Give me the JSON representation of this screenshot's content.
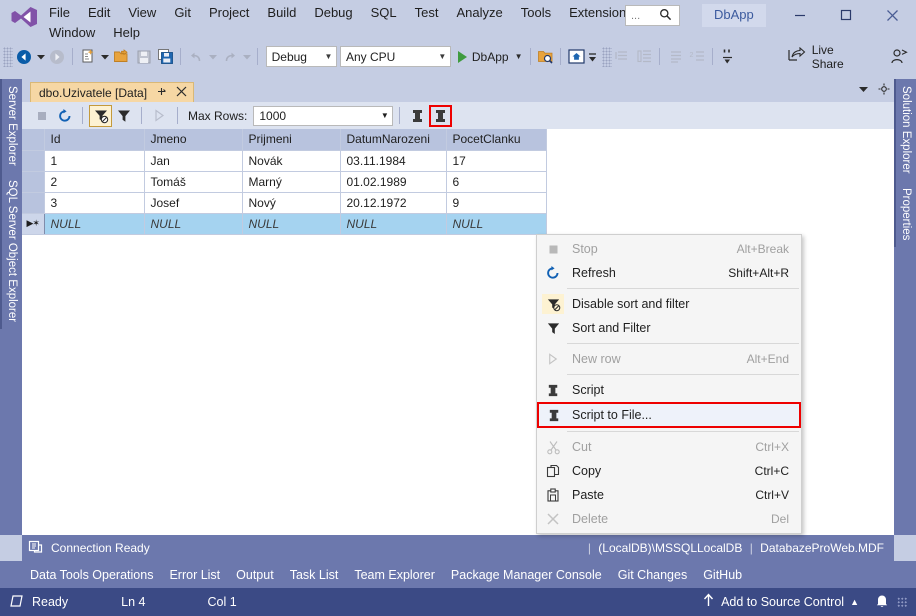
{
  "window": {
    "title": "DbApp",
    "logo_icon": "visual-studio-logo",
    "minimize_icon": "minimize-icon",
    "maximize_icon": "maximize-icon",
    "close_icon": "close-icon"
  },
  "menubar": {
    "row1": [
      "File",
      "Edit",
      "View",
      "Git",
      "Project",
      "Build",
      "Debug",
      "SQL",
      "Test",
      "Analyze",
      "Tools",
      "Extensions"
    ],
    "row2": [
      "Window",
      "Help"
    ],
    "search": {
      "dots": "...",
      "icon": "search-icon",
      "placeholder": "Search"
    }
  },
  "toolbar": {
    "back_icon": "navigate-back-icon",
    "forward_icon": "navigate-forward-icon",
    "new_item_icon": "new-item-icon",
    "open_icon": "open-file-icon",
    "save_icon": "save-icon",
    "save_all_icon": "save-all-icon",
    "undo_icon": "undo-icon",
    "redo_icon": "redo-icon",
    "config": "Debug",
    "platform": "Any CPU",
    "run_label": "DbApp",
    "run_icon": "play-icon",
    "find_icon": "find-in-files-icon",
    "home_icon": "solution-home-icon",
    "indent_left_icon": "outdent-icon",
    "indent_right_icon": "indent-icon",
    "comment_icon": "comment-icon",
    "uncomment_icon": "uncomment-icon",
    "bookmark_icon": "bookmark-icon",
    "live_share_label": "Live Share",
    "live_share_icon": "live-share-icon",
    "feedback_icon": "send-feedback-icon"
  },
  "dock_left": [
    "Server Explorer",
    "SQL Server Object Explorer"
  ],
  "dock_right": [
    "Solution Explorer",
    "Properties"
  ],
  "document": {
    "tab_title": "dbo.Uzivatele [Data]",
    "pin_icon": "pin-icon",
    "close_icon": "close-tab-icon",
    "tab_list_icon": "tab-list-icon",
    "tab_menu_icon": "tab-menu-icon"
  },
  "grid_toolbar": {
    "stop_icon": "stop-icon",
    "refresh_icon": "refresh-icon",
    "disable_sort_filter_icon": "disable-sort-filter-icon",
    "sort_filter_icon": "sort-filter-icon",
    "new_row_icon": "new-row-icon",
    "max_rows_label": "Max Rows:",
    "max_rows_value": "1000",
    "script_icon": "script-icon",
    "script_to_file_icon": "script-to-file-icon"
  },
  "grid": {
    "columns": [
      "Id",
      "Jmeno",
      "Prijmeni",
      "DatumNarozeni",
      "PocetClanku"
    ],
    "rows": [
      {
        "Id": "1",
        "Jmeno": "Jan",
        "Prijmeni": "Novák",
        "DatumNarozeni": "03.11.1984",
        "PocetClanku": "17"
      },
      {
        "Id": "2",
        "Jmeno": "Tomáš",
        "Prijmeni": "Marný",
        "DatumNarozeni": "01.02.1989",
        "PocetClanku": "6"
      },
      {
        "Id": "3",
        "Jmeno": "Josef",
        "Prijmeni": "Nový",
        "DatumNarozeni": "20.12.1972",
        "PocetClanku": "9"
      }
    ],
    "new_row": {
      "Id": "NULL",
      "Jmeno": "NULL",
      "Prijmeni": "NULL",
      "DatumNarozeni": "NULL",
      "PocetClanku": "NULL"
    },
    "new_row_marker": "▶✶"
  },
  "context_menu": {
    "items": [
      {
        "label": "Stop",
        "shortcut": "Alt+Break",
        "icon": "stop-icon",
        "disabled": true,
        "highlighted": false
      },
      {
        "label": "Refresh",
        "shortcut": "Shift+Alt+R",
        "icon": "refresh-icon",
        "disabled": false,
        "highlighted": false
      },
      {
        "separator": true
      },
      {
        "label": "Disable sort and filter",
        "shortcut": "",
        "icon": "disable-sort-filter-icon",
        "disabled": false,
        "highlighted": false
      },
      {
        "label": "Sort and Filter",
        "shortcut": "",
        "icon": "sort-filter-icon",
        "disabled": false,
        "highlighted": false
      },
      {
        "separator": true
      },
      {
        "label": "New row",
        "shortcut": "Alt+End",
        "icon": "new-row-icon",
        "disabled": true,
        "highlighted": false
      },
      {
        "separator": true
      },
      {
        "label": "Script",
        "shortcut": "",
        "icon": "script-icon",
        "disabled": false,
        "highlighted": false
      },
      {
        "label": "Script to File...",
        "shortcut": "",
        "icon": "script-to-file-icon",
        "disabled": false,
        "highlighted": true
      },
      {
        "separator": true
      },
      {
        "label": "Cut",
        "shortcut": "Ctrl+X",
        "icon": "cut-icon",
        "disabled": true,
        "highlighted": false
      },
      {
        "label": "Copy",
        "shortcut": "Ctrl+C",
        "icon": "copy-icon",
        "disabled": false,
        "highlighted": false
      },
      {
        "label": "Paste",
        "shortcut": "Ctrl+V",
        "icon": "paste-icon",
        "disabled": false,
        "highlighted": false
      },
      {
        "label": "Delete",
        "shortcut": "Del",
        "icon": "delete-icon",
        "disabled": true,
        "highlighted": false
      }
    ]
  },
  "connection_bar": {
    "icon": "database-connection-icon",
    "status": "Connection Ready",
    "server": "(LocalDB)\\MSSQLLocalDB",
    "database": "DatabazeProWeb.MDF",
    "separator": "|"
  },
  "panel_tabs": [
    "Data Tools Operations",
    "Error List",
    "Output",
    "Task List",
    "Team Explorer",
    "Package Manager Console",
    "Git Changes",
    "GitHub"
  ],
  "statusbar": {
    "icon": "ready-icon",
    "ready": "Ready",
    "line": "Ln 4",
    "col": "Col 1",
    "source_control": "Add to Source Control",
    "source_control_icon": "upload-arrow-icon",
    "chevron": "▲",
    "bell_icon": "notifications-icon"
  },
  "colors": {
    "chrome": "#c5cde3",
    "dock": "#6c78ad",
    "statusbar": "#3b4a85",
    "tab_active": "#f6d7a4",
    "grid_header": "#b8c3de",
    "new_row": "#a5d3f0",
    "highlight_red": "#ee0000",
    "accent_blue": "#3b5a9e"
  }
}
